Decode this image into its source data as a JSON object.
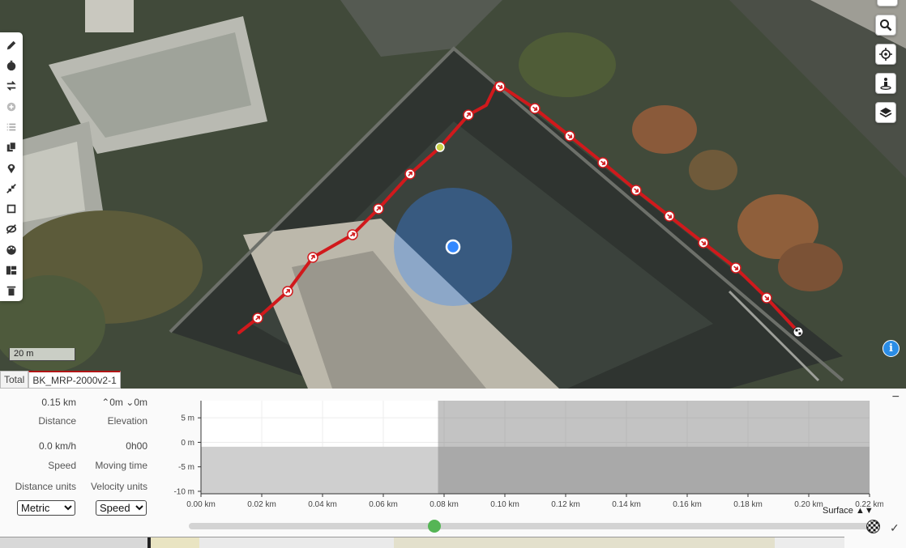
{
  "map": {
    "scale_label": "20 m",
    "info_label": "i",
    "track_tabs": [
      "Total",
      "BK_MRP-2000v2-1"
    ],
    "route_color": "#d1191c",
    "location_color": "#3388ff",
    "left_tools": [
      "pencil-icon",
      "stopwatch-icon",
      "reverse-icon",
      "add-circle-icon",
      "list-icon",
      "copy-icon",
      "map-pin-icon",
      "collapse-icon",
      "crop-icon",
      "hide-icon",
      "palette-icon",
      "merge-icon",
      "trash-icon"
    ],
    "right_tools": [
      "search-icon",
      "locate-icon",
      "street-view-icon",
      "layers-icon"
    ]
  },
  "stats": {
    "distance": {
      "value": "0.15 km",
      "label": "Distance"
    },
    "elevation": {
      "up": "0m",
      "down": "0m",
      "label": "Elevation"
    },
    "speed": {
      "value": "0.0 km/h",
      "label": "Speed"
    },
    "moving_time": {
      "value": "0h00",
      "label": "Moving time"
    },
    "distance_units": {
      "label": "Distance units",
      "selected": "Metric"
    },
    "velocity_units": {
      "label": "Velocity units",
      "selected": "Speed"
    }
  },
  "chart_data": {
    "type": "area",
    "x_ticks": [
      "0.00 km",
      "0.02 km",
      "0.04 km",
      "0.06 km",
      "0.08 km",
      "0.10 km",
      "0.12 km",
      "0.14 km",
      "0.16 km",
      "0.18 km",
      "0.20 km",
      "0.22 km"
    ],
    "y_ticks": [
      "5 m",
      "0 m",
      "-5 m",
      "-10 m"
    ],
    "xlim": [
      0,
      0.22
    ],
    "ylim": [
      -10.5,
      8.5
    ],
    "elevation_fill_top": -0.9,
    "highlight_start": 0.078,
    "series": [
      {
        "x": [
          0,
          0.078,
          0.22
        ],
        "y": [
          -0.9,
          -0.9,
          -0.9
        ]
      }
    ],
    "surface_label": "Surface",
    "surface_arrows": "▲▼"
  },
  "slider": {
    "position_fraction": 0.358
  },
  "collapse_label": "−",
  "confirm_label": "✓"
}
